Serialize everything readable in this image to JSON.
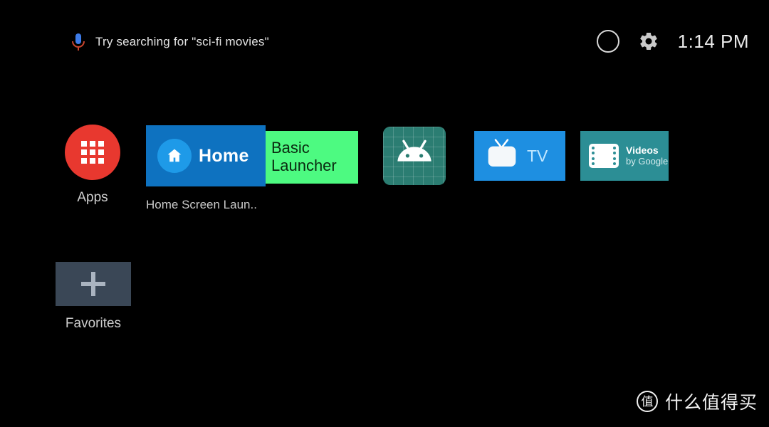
{
  "statusbar": {
    "mic_icon": "microphone-icon",
    "search_hint": "Try searching for \"sci-fi movies\"",
    "circle_icon": "circle-outline-icon",
    "gear_icon": "gear-icon",
    "time": "1:14 PM"
  },
  "apps_row": {
    "apps_launcher": {
      "icon": "apps-grid-icon",
      "label": "Apps",
      "color": "#e8382f"
    },
    "home_banner": {
      "home_icon": "home-house-icon",
      "home_label": "Home",
      "home_color": "#0e72c0",
      "overlay_line1": "Basic",
      "overlay_line2": "Launcher",
      "overlay_color": "#4dfa81",
      "sublabel": "Home Screen Laun.."
    },
    "android_tile": {
      "icon": "android-robot-icon",
      "color": "#2b7d72"
    },
    "tv_tile": {
      "icon": "television-icon",
      "label": "TV",
      "color": "#1e8fe1"
    },
    "videos_tile": {
      "icon": "film-strip-icon",
      "title": "Videos",
      "subtitle": "by Google",
      "color": "#2c8e95"
    }
  },
  "favorites_row": {
    "add_icon": "plus-icon",
    "label": "Favorites",
    "color": "#3a4756"
  },
  "watermark": {
    "badge": "值",
    "text": "什么值得买"
  }
}
